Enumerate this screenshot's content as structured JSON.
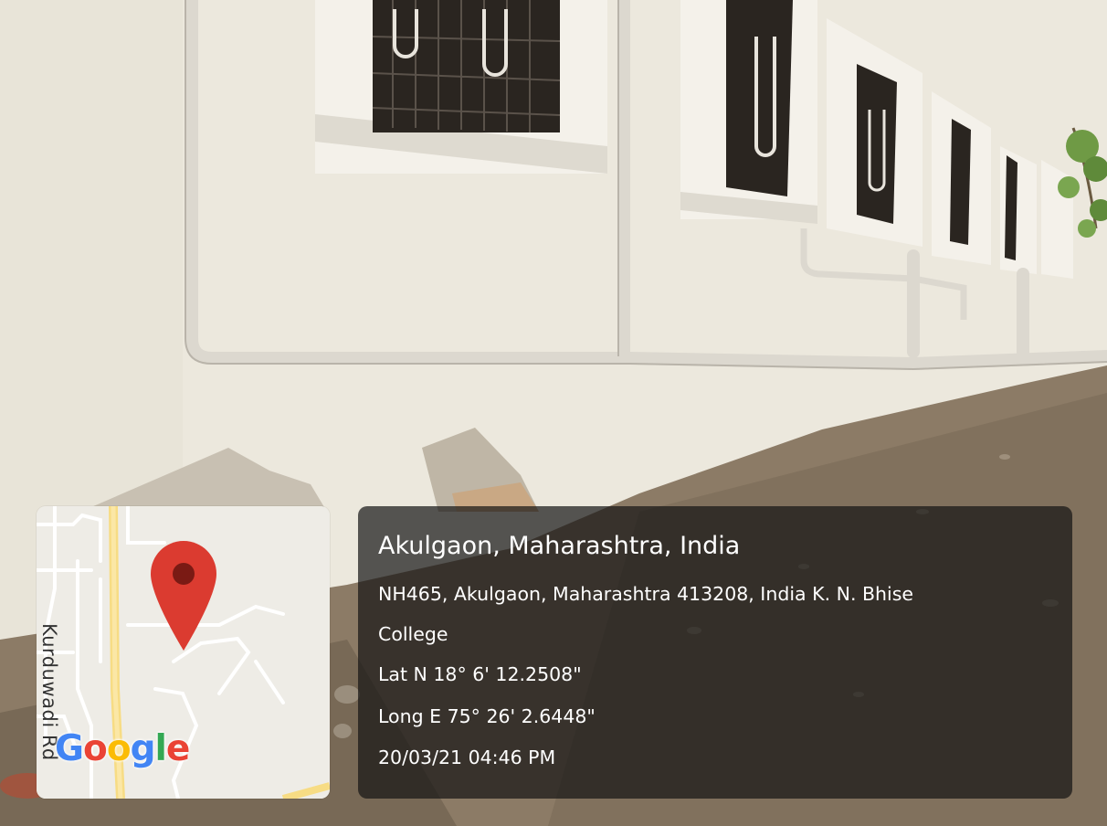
{
  "photo": {
    "subject": "white-building-wall-with-pipes-and-windows"
  },
  "map": {
    "road_label": "Kurduwadi Rd",
    "logo_letters": [
      "G",
      "o",
      "o",
      "g",
      "l",
      "e"
    ],
    "logo_colors": [
      "#4285F4",
      "#EA4335",
      "#FBBC05",
      "#4285F4",
      "#34A853",
      "#EA4335"
    ],
    "pin_color": "#DB3B30",
    "pin_icon": "location-pin-icon"
  },
  "location": {
    "title": "Akulgaon, Maharashtra, India",
    "address_line1": "NH465, Akulgaon, Maharashtra 413208, India K. N. Bhise",
    "address_line2": "College",
    "latitude": "Lat N 18° 6' 12.2508\"",
    "longitude": "Long E 75° 26' 2.6448\"",
    "timestamp": "20/03/21 04:46 PM"
  }
}
